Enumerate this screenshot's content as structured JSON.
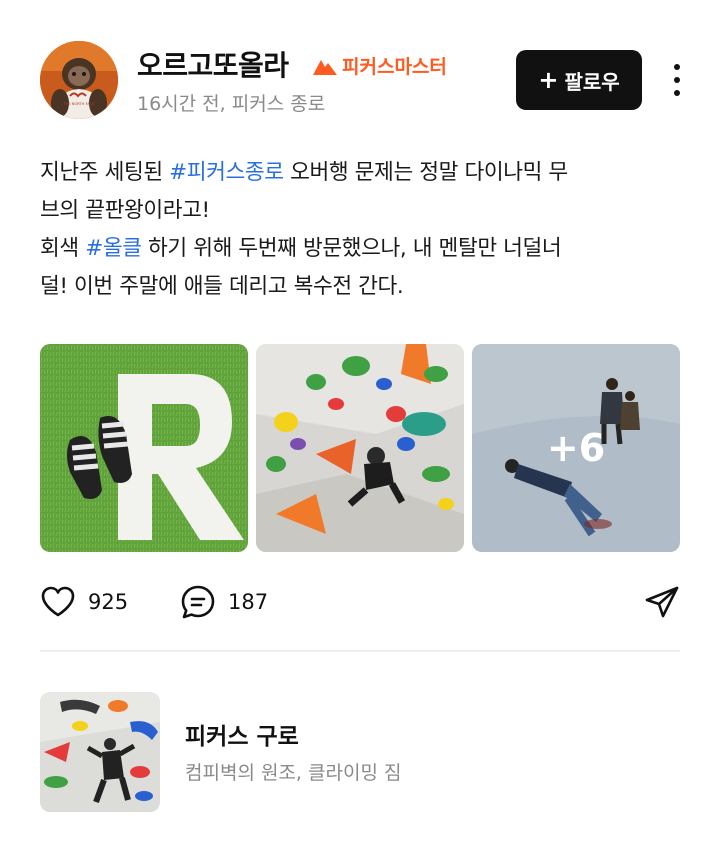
{
  "post": {
    "author": {
      "name": "오르고또올라",
      "badge_label": "피커스마스터",
      "meta": "16시간 전, 피커스 종로",
      "avatar_logo_text": "THE NORTH FACE"
    },
    "follow_label": "팔로우",
    "body": {
      "line1_before": "지난주 세팅된 ",
      "line1_tag": "#피커스종로",
      "line1_after": " 오버행 문제는 정말 다이나믹 무",
      "line2": "브의 끝판왕이라고!",
      "line3_before": "회색 ",
      "line3_tag": "#올클",
      "line3_after": " 하기 위해 두번째 방문했으나, 내 멘탈만 너덜너",
      "line4": "덜! 이번 주말에 애들 데리고 복수전 간다."
    },
    "photos": {
      "more_count": "+6"
    },
    "actions": {
      "like_count": "925",
      "comment_count": "187"
    },
    "place": {
      "name": "피커스 구로",
      "description": "컴피벽의 원조, 클라이밍 짐"
    }
  },
  "colors": {
    "accent_orange": "#ff5a1f",
    "hashtag_blue": "#2a6fe0",
    "follow_button_bg": "#111111"
  },
  "icons": {
    "badge": "mountain-icon",
    "like": "heart-icon",
    "comment": "comment-bubble-icon",
    "share": "paper-plane-icon",
    "more": "vertical-dots-icon"
  }
}
